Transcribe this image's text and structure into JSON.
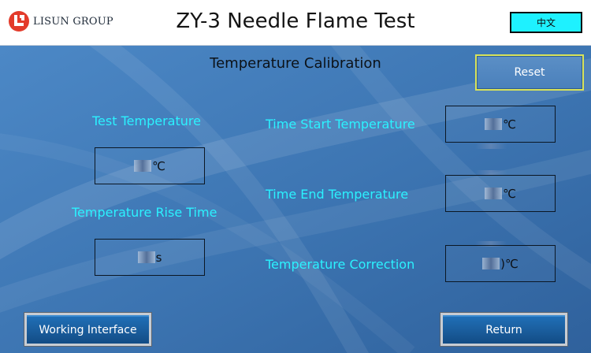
{
  "header": {
    "brand": "LISUN GROUP",
    "title": "ZY-3 Needle Flame Test",
    "language_button": "中文"
  },
  "page": {
    "subtitle": "Temperature Calibration",
    "reset_button": "Reset"
  },
  "left_panel": {
    "test_temperature": {
      "label": "Test Temperature",
      "unit": "℃"
    },
    "rise_time": {
      "label": "Temperature Rise Time",
      "unit": "s"
    }
  },
  "right_panel": {
    "start_temperature": {
      "label": "Time Start Temperature",
      "unit": "℃"
    },
    "end_temperature": {
      "label": "Time End Temperature",
      "unit": "℃"
    },
    "correction": {
      "label": "Temperature Correction",
      "unit": "℃",
      "visible_digit_fragment": ")"
    }
  },
  "footer": {
    "working_interface_button": "Working Interface",
    "return_button": "Return"
  },
  "colors": {
    "background": "#3f79b8",
    "label_cyan": "#2bf2ff",
    "language_button_bg": "#1ef1ff",
    "reset_border": "#d8e35a",
    "logo_red": "#e33b2b"
  },
  "icons": {
    "logo": "lisun-logo-icon"
  }
}
